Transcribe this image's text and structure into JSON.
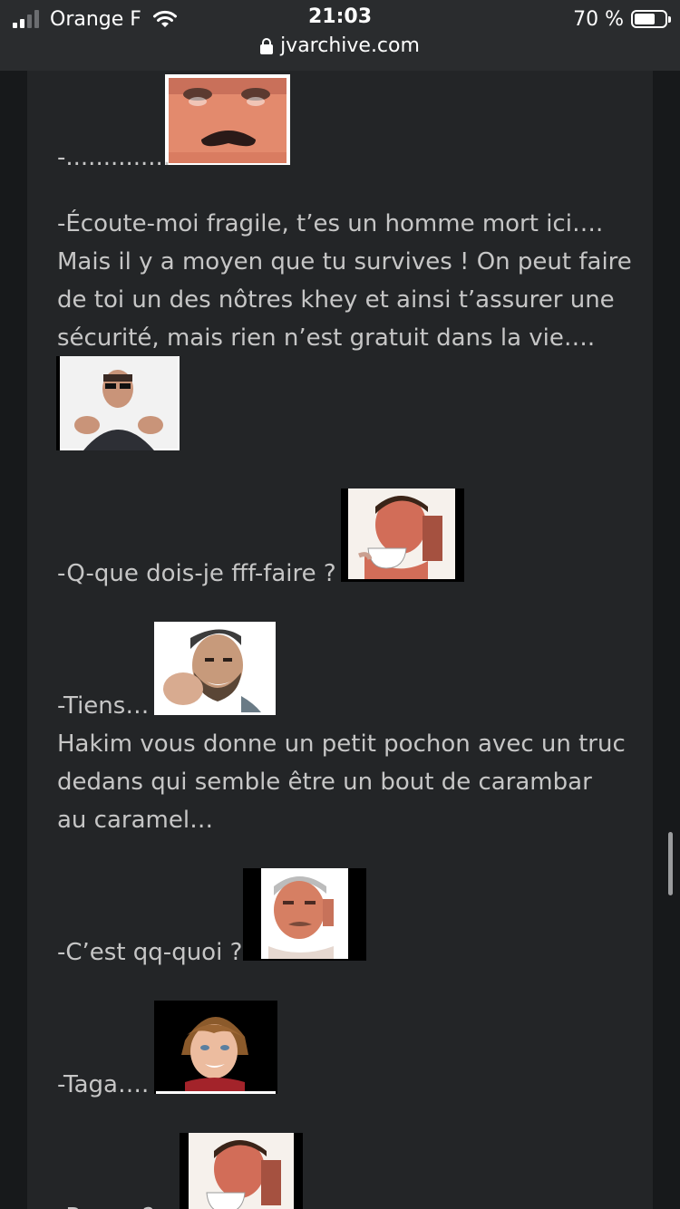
{
  "status_bar": {
    "carrier": "Orange F",
    "time": "21:03",
    "battery": "70 %",
    "battery_level": 0.7,
    "url": "jvarchive.com"
  },
  "post": {
    "lines": [
      "-..............",
      "-Écoute-moi fragile, t’es un homme mort ici….",
      "Mais il y a moyen que tu survives ! On peut faire",
      "de toi un des nôtres khey et ainsi t’assurer une",
      "sécurité, mais rien n’est gratuit dans la vie….",
      "-Q-que dois-je fff-faire ?",
      "-Tiens…",
      "Hakim vous donne un petit pochon avec un truc",
      "dedans qui semble être un bout de carambar",
      "au caramel…",
      "-C’est qq-quoi ?",
      "-Taga….",
      "-R.....…?"
    ],
    "stickers": [
      {
        "name": "risitas-sticker"
      },
      {
        "name": "man-sunglasses-sticker"
      },
      {
        "name": "risitas-tea-sticker"
      },
      {
        "name": "man-cap-smiling-sticker"
      },
      {
        "name": "risitas-suspicious-sticker"
      },
      {
        "name": "young-singer-sticker"
      },
      {
        "name": "risitas-tea-sticker"
      }
    ]
  }
}
